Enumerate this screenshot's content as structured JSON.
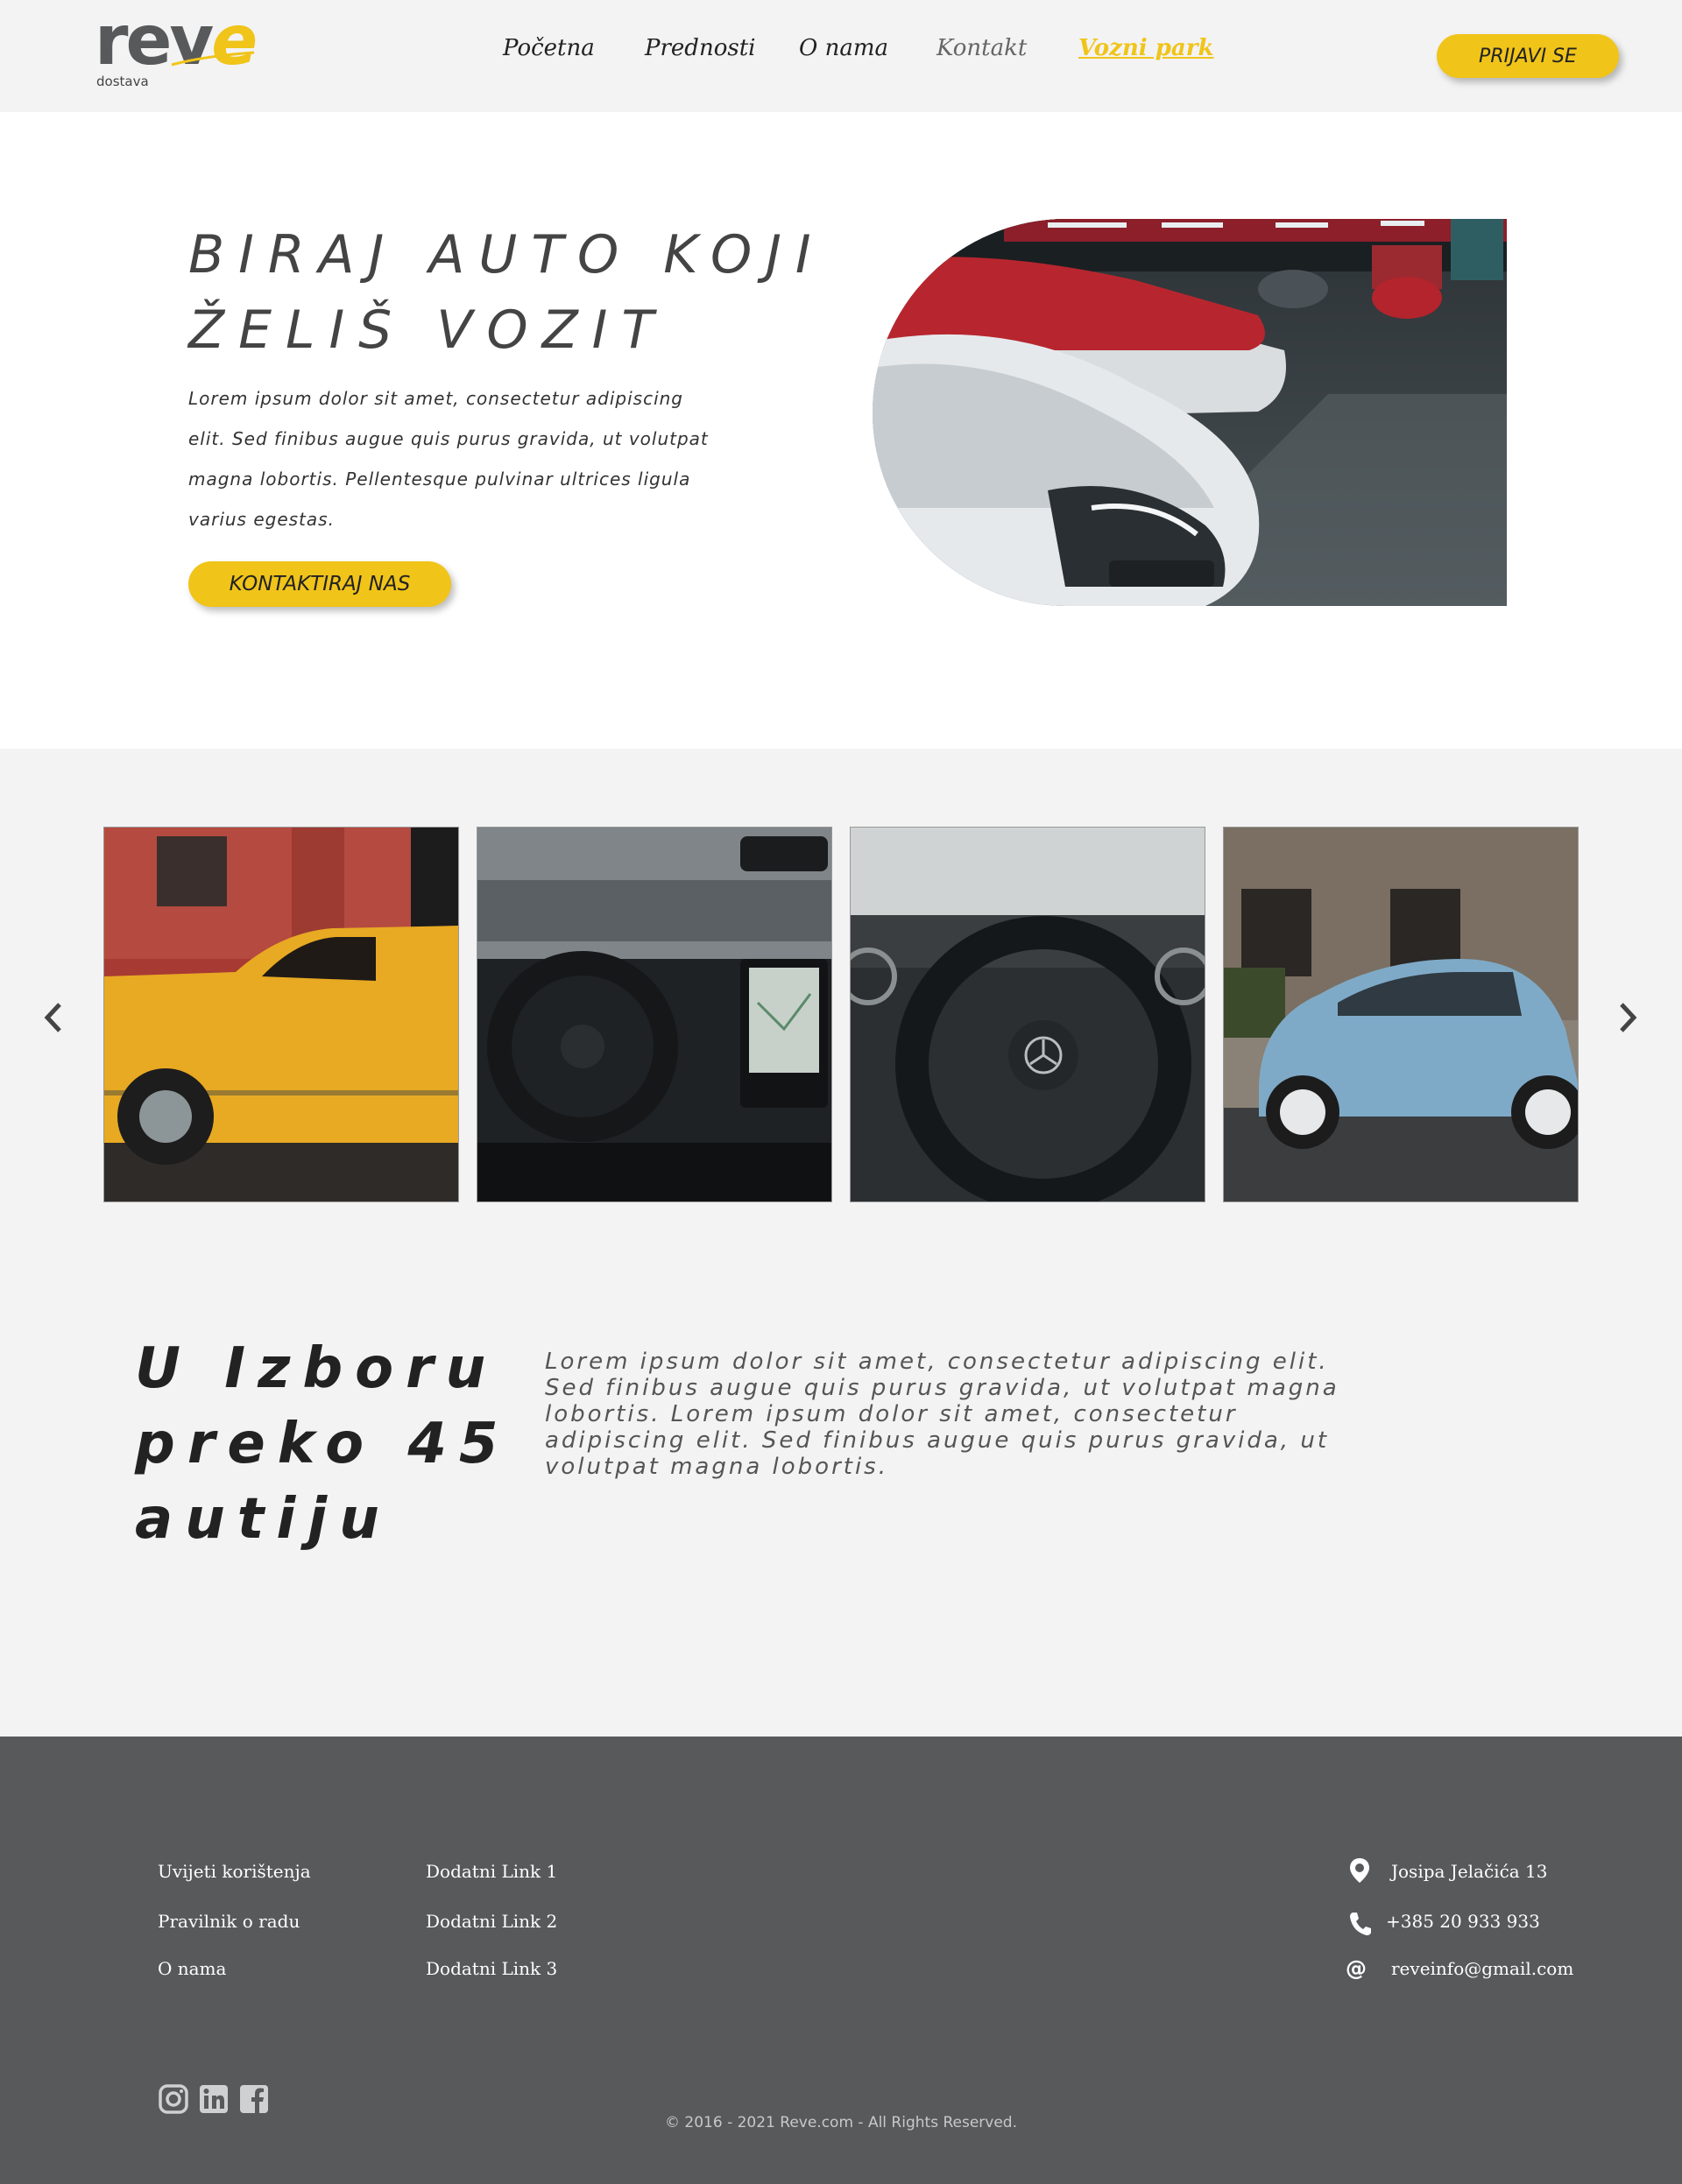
{
  "brand": {
    "logo_main": "rev",
    "logo_e": "e",
    "logo_sub": "dostava",
    "accent_color": "#f0c419",
    "header_bg": "#f3f3f3",
    "footer_bg": "#58595b"
  },
  "nav": {
    "items": [
      "Početna",
      "Prednosti",
      "O nama",
      "Kontakt",
      "Vozni park"
    ],
    "active": "Vozni park",
    "login_label": "PRIJAVI SE"
  },
  "hero": {
    "title_line1": "BIRAJ AUTO KOJI",
    "title_line2": "ŽELIŠ VOZIT",
    "text_line1": "Lorem ipsum dolor sit amet, consectetur adipiscing",
    "text_line2": "elit. Sed finibus augue quis purus gravida, ut volutpat",
    "text_line3": "magna lobortis. Pellentesque pulvinar ultrices ligula",
    "text_line4": "varius egestas.",
    "cta_label": "KONTAKTIRAJ NAS"
  },
  "carousel": {
    "prev_icon": "chevron-left-icon",
    "next_icon": "chevron-right-icon",
    "slides": [
      "yellow-classic-car",
      "truck-interior",
      "mercedes-steering-wheel",
      "blue-fiat-500"
    ]
  },
  "info": {
    "title_line1": "U Izboru",
    "title_line2": "preko 45",
    "title_line3": "autiju",
    "text_line1": "Lorem ipsum dolor sit amet, consectetur adipiscing elit.",
    "text_line2": "Sed finibus augue quis purus gravida, ut volutpat magna",
    "text_line3": "lobortis. Lorem ipsum dolor sit amet, consectetur",
    "text_line4": "adipiscing elit. Sed finibus augue quis purus gravida, ut",
    "text_line5": "volutpat magna lobortis."
  },
  "footer": {
    "links_col1": [
      "Uvijeti korištenja",
      "Pravilnik o radu",
      "O nama"
    ],
    "links_col2": [
      "Dodatni Link 1",
      "Dodatni Link 2",
      "Dodatni Link 3"
    ],
    "address": "Josipa Jelačića 13",
    "phone": "+385 20 933 933",
    "email": "reveinfo@gmail.com",
    "social": [
      "instagram-icon",
      "linkedin-icon",
      "facebook-icon"
    ],
    "copyright": "© 2016 - 2021 Reve.com - All Rights Reserved."
  }
}
